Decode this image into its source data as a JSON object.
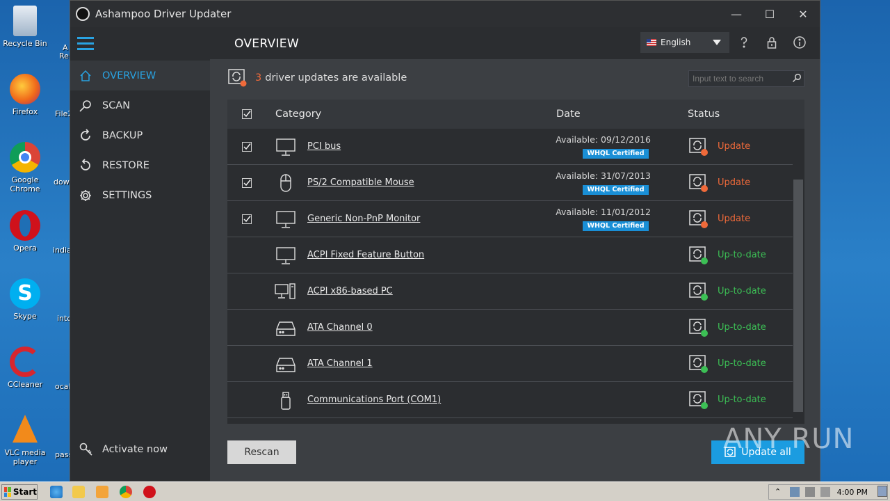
{
  "desktop": {
    "icons": [
      {
        "label": "Recycle Bin"
      },
      {
        "label": "Firefox"
      },
      {
        "label": "Google Chrome"
      },
      {
        "label": "Opera"
      },
      {
        "label": "Skype"
      },
      {
        "label": "CCleaner"
      },
      {
        "label": "VLC media player"
      }
    ],
    "partial_labels": [
      "A",
      "Re",
      "File2",
      "dow",
      "india",
      "into",
      "ocal",
      "pass"
    ]
  },
  "window": {
    "title": "Ashampoo Driver Updater",
    "controls": {
      "minimize": "—",
      "maximize": "☐",
      "close": "✕"
    }
  },
  "header": {
    "page_title": "OVERVIEW",
    "language": "English"
  },
  "sidebar": {
    "items": [
      {
        "label": "OVERVIEW",
        "icon": "home-icon",
        "active": true
      },
      {
        "label": "SCAN",
        "icon": "magnifier-icon",
        "active": false
      },
      {
        "label": "BACKUP",
        "icon": "backup-icon",
        "active": false
      },
      {
        "label": "RESTORE",
        "icon": "restore-icon",
        "active": false
      },
      {
        "label": "SETTINGS",
        "icon": "gear-icon",
        "active": false
      }
    ],
    "activate_label": "Activate now"
  },
  "banner": {
    "count": "3",
    "text": "driver updates are available"
  },
  "search": {
    "placeholder": "Input text to search"
  },
  "table": {
    "headers": {
      "category": "Category",
      "date": "Date",
      "status": "Status"
    },
    "rows": [
      {
        "checked": true,
        "icon": "monitor-icon",
        "name": "PCI bus",
        "date": "Available: 09/12/2016",
        "badge": "WHQL Certified",
        "status": "Update",
        "state": "update"
      },
      {
        "checked": true,
        "icon": "mouse-icon",
        "name": "PS/2 Compatible Mouse",
        "date": "Available: 31/07/2013",
        "badge": "WHQL Certified",
        "status": "Update",
        "state": "update"
      },
      {
        "checked": true,
        "icon": "monitor-icon",
        "name": "Generic Non-PnP Monitor",
        "date": "Available: 11/01/2012",
        "badge": "WHQL Certified",
        "status": "Update",
        "state": "update"
      },
      {
        "checked": false,
        "icon": "monitor-icon",
        "name": "ACPI Fixed Feature Button",
        "date": "",
        "badge": "",
        "status": "Up-to-date",
        "state": "ok"
      },
      {
        "checked": false,
        "icon": "pc-icon",
        "name": "ACPI x86-based PC",
        "date": "",
        "badge": "",
        "status": "Up-to-date",
        "state": "ok"
      },
      {
        "checked": false,
        "icon": "drive-icon",
        "name": "ATA Channel 0",
        "date": "",
        "badge": "",
        "status": "Up-to-date",
        "state": "ok"
      },
      {
        "checked": false,
        "icon": "drive-icon",
        "name": "ATA Channel 1",
        "date": "",
        "badge": "",
        "status": "Up-to-date",
        "state": "ok"
      },
      {
        "checked": false,
        "icon": "usb-icon",
        "name": "Communications Port (COM1)",
        "date": "",
        "badge": "",
        "status": "Up-to-date",
        "state": "ok"
      }
    ]
  },
  "buttons": {
    "rescan": "Rescan",
    "update_all": "Update all"
  },
  "watermark": "ANY RUN",
  "taskbar": {
    "start": "Start",
    "clock": "4:00 PM"
  },
  "colors": {
    "accent": "#29a3e2",
    "update": "#f06a3a",
    "ok": "#3cbf55",
    "badge": "#1a8fd6"
  }
}
